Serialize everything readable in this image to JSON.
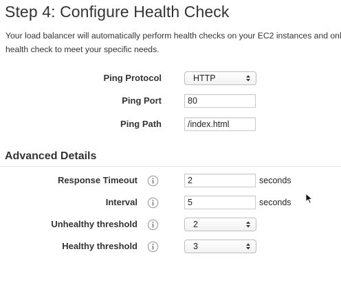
{
  "header": {
    "title": "Step 4: Configure Health Check",
    "description_line1": "Your load balancer will automatically perform health checks on your EC2 instances and only route traffic to instances that pass the",
    "description_line2": "health check to meet your specific needs."
  },
  "health_check": {
    "ping_protocol": {
      "label": "Ping Protocol",
      "value": "HTTP"
    },
    "ping_port": {
      "label": "Ping Port",
      "value": "80"
    },
    "ping_path": {
      "label": "Ping Path",
      "value": "/index.html"
    }
  },
  "advanced": {
    "title": "Advanced Details",
    "response_timeout": {
      "label": "Response Timeout",
      "value": "2",
      "unit": "seconds"
    },
    "interval": {
      "label": "Interval",
      "value": "5",
      "unit": "seconds"
    },
    "unhealthy_threshold": {
      "label": "Unhealthy threshold",
      "value": "2"
    },
    "healthy_threshold": {
      "label": "Healthy threshold",
      "value": "3"
    }
  },
  "icons": {
    "info": "info-icon",
    "select_arrows": "updown-arrows-icon",
    "cursor": "mouse-cursor-icon"
  },
  "colors": {
    "text": "#333333",
    "input_border": "#c9c9c9",
    "info_icon": "#9a9a9a"
  }
}
